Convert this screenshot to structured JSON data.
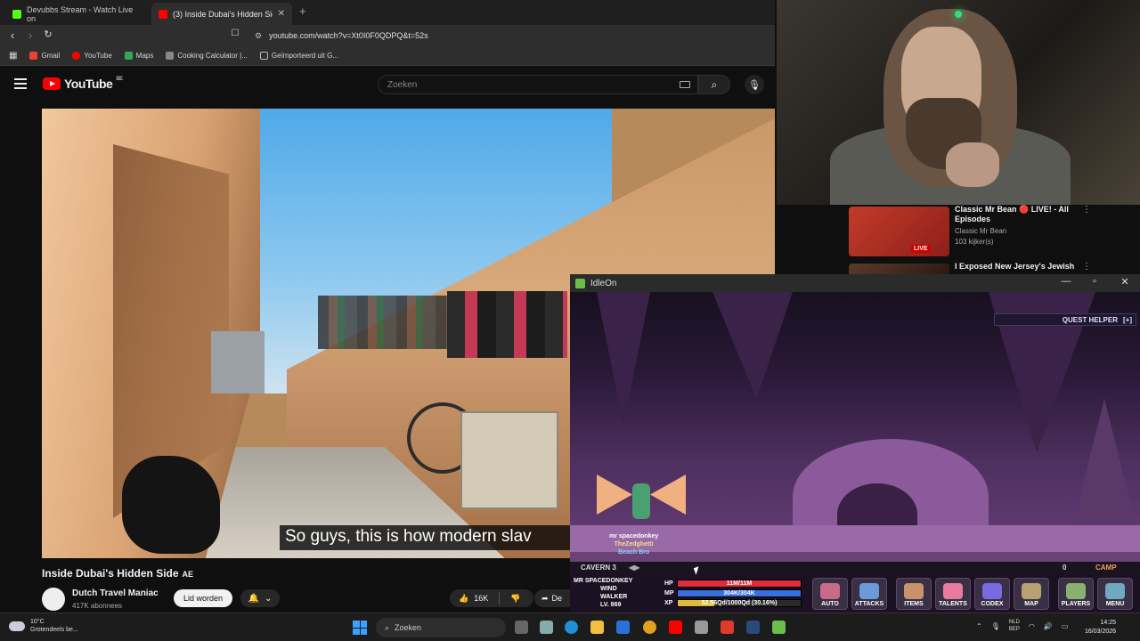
{
  "browser": {
    "tabs": [
      {
        "title": "Devubbs Stream - Watch Live on",
        "active": false,
        "favicon_color": "#53fc18"
      },
      {
        "title": "(3) Inside Dubai's Hidden Side",
        "active": true,
        "favicon_color": "#ff0000"
      }
    ],
    "new_tab": "+",
    "url": "youtube.com/watch?v=Xt0I0F0QDPQ&t=52s",
    "bookmarks": [
      {
        "label": "Gmail",
        "icon": "gmail-icon",
        "color": "#ea4335"
      },
      {
        "label": "YouTube",
        "icon": "youtube-icon",
        "color": "#ff0000"
      },
      {
        "label": "Maps",
        "icon": "maps-icon",
        "color": "#34a853"
      },
      {
        "label": "Cooking Calculator |...",
        "icon": "cooking-icon",
        "color": "#888888"
      },
      {
        "label": "Geïmporteerd uit G...",
        "icon": "folder-icon",
        "color": "#bbbbbb"
      }
    ]
  },
  "youtube": {
    "logo": "YouTube",
    "region": "BE",
    "search_placeholder": "Zoeken",
    "subtitle": "So guys, this is how modern slav",
    "video_title": "Inside Dubai's Hidden Side",
    "video_flag": "AE",
    "channel_name": "Dutch Travel Maniac",
    "channel_subs": "417K abonnees",
    "join_label": "Lid worden",
    "like_count": "16K",
    "share_label": "De"
  },
  "recommended": [
    {
      "title": "Classic Mr Bean 🔴 LIVE! - All Episodes",
      "channel": "Classic Mr Bean",
      "views": "103 kijker(s)",
      "badge": "LIVE"
    },
    {
      "title": "I Exposed New Jersey's Jewish",
      "channel": "",
      "views": "",
      "badge": ""
    }
  ],
  "idleon": {
    "window_title": "IdleOn",
    "quest_helper": "QUEST HELPER",
    "quest_toggle": "[+]",
    "zone": "CAVERN 3",
    "players_count": "0",
    "camp_label": "CAMP",
    "player_tag1": "mr spacedonkey",
    "player_tag2": "TheZedghetti",
    "player_tag3": "Beach Bro",
    "char_name": "MR SPACEDONKEY",
    "char_class1": "WIND",
    "char_class2": "WALKER",
    "char_level": "LV. 869",
    "hp": "11M/11M",
    "mp": "304K/304K",
    "xp": "52.56Qd/1000Qd (30.16%)",
    "hp_color": "#e02b3a",
    "mp_color": "#3a6fe0",
    "xp_color": "#e0b83a",
    "buttons": [
      "AUTO",
      "ATTACKS",
      "ITEMS",
      "TALENTS",
      "CODEX",
      "MAP",
      "PLAYERS",
      "MENU"
    ]
  },
  "taskbar": {
    "temp": "10°C",
    "weather": "Grotendeels be...",
    "search": "Zoeken",
    "lang1": "NLD",
    "lang2": "BEP",
    "time": "14:25",
    "date": "16/03/2026"
  }
}
